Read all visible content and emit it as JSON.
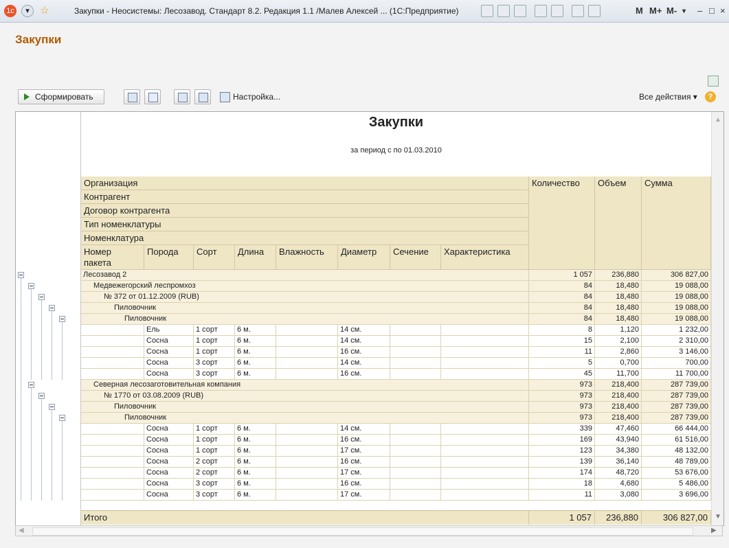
{
  "window": {
    "title": "Закупки - Неосистемы: Лесозавод. Стандарт 8.2. Редакция 1.1 /Малев Алексей ... (1С:Предприятие)",
    "memory_buttons": [
      "M",
      "M+",
      "M-"
    ]
  },
  "page": {
    "title": "Закупки"
  },
  "toolbar": {
    "form_label": "Сформировать",
    "setup_label": "Настройка...",
    "all_actions_label": "Все действия ▾"
  },
  "report": {
    "title": "Закупки",
    "subtitle": "за период с  по 01.03.2010",
    "headers": {
      "organization": "Организация",
      "counterparty": "Контрагент",
      "contract": "Договор контрагента",
      "nomenclature_type": "Тип номенклатуры",
      "nomenclature": "Номенклатура",
      "package_number": "Номер пакета",
      "breed": "Порода",
      "grade": "Сорт",
      "length": "Длина",
      "moisture": "Влажность",
      "diameter": "Диаметр",
      "section": "Сечение",
      "characteristic": "Характеристика",
      "quantity": "Количество",
      "volume": "Объем",
      "sum": "Сумма"
    },
    "rows": [
      {
        "type": "group",
        "level": 0,
        "label": "Лесозавод 2",
        "qty": "1 057",
        "vol": "236,880",
        "sum": "306 827,00"
      },
      {
        "type": "group",
        "level": 1,
        "label": "Медвежегорский леспромхоз",
        "qty": "84",
        "vol": "18,480",
        "sum": "19 088,00"
      },
      {
        "type": "group",
        "level": 2,
        "label": "№ 372 от 01.12.2009 (RUB)",
        "qty": "84",
        "vol": "18,480",
        "sum": "19 088,00"
      },
      {
        "type": "group",
        "level": 3,
        "label": "Пиловочник",
        "qty": "84",
        "vol": "18,480",
        "sum": "19 088,00"
      },
      {
        "type": "group",
        "level": 4,
        "label": "Пиловочник",
        "qty": "84",
        "vol": "18,480",
        "sum": "19 088,00"
      },
      {
        "type": "detail",
        "breed": "Ель",
        "grade": "1 сорт",
        "length": "6 м.",
        "diameter": "14 см.",
        "qty": "8",
        "vol": "1,120",
        "sum": "1 232,00"
      },
      {
        "type": "detail",
        "breed": "Сосна",
        "grade": "1 сорт",
        "length": "6 м.",
        "diameter": "14 см.",
        "qty": "15",
        "vol": "2,100",
        "sum": "2 310,00"
      },
      {
        "type": "detail",
        "breed": "Сосна",
        "grade": "1 сорт",
        "length": "6 м.",
        "diameter": "16 см.",
        "qty": "11",
        "vol": "2,860",
        "sum": "3 146,00"
      },
      {
        "type": "detail",
        "breed": "Сосна",
        "grade": "3 сорт",
        "length": "6 м.",
        "diameter": "14 см.",
        "qty": "5",
        "vol": "0,700",
        "sum": "700,00"
      },
      {
        "type": "detail",
        "breed": "Сосна",
        "grade": "3 сорт",
        "length": "6 м.",
        "diameter": "16 см.",
        "qty": "45",
        "vol": "11,700",
        "sum": "11 700,00"
      },
      {
        "type": "group",
        "level": 1,
        "label": "Северная лесозаготовительная компания",
        "qty": "973",
        "vol": "218,400",
        "sum": "287 739,00"
      },
      {
        "type": "group",
        "level": 2,
        "label": "№ 1770 от 03.08.2009 (RUB)",
        "qty": "973",
        "vol": "218,400",
        "sum": "287 739,00"
      },
      {
        "type": "group",
        "level": 3,
        "label": "Пиловочник",
        "qty": "973",
        "vol": "218,400",
        "sum": "287 739,00"
      },
      {
        "type": "group",
        "level": 4,
        "label": "Пиловочник",
        "qty": "973",
        "vol": "218,400",
        "sum": "287 739,00"
      },
      {
        "type": "detail",
        "breed": "Сосна",
        "grade": "1 сорт",
        "length": "6 м.",
        "diameter": "14 см.",
        "qty": "339",
        "vol": "47,460",
        "sum": "66 444,00"
      },
      {
        "type": "detail",
        "breed": "Сосна",
        "grade": "1 сорт",
        "length": "6 м.",
        "diameter": "16 см.",
        "qty": "169",
        "vol": "43,940",
        "sum": "61 516,00"
      },
      {
        "type": "detail",
        "breed": "Сосна",
        "grade": "1 сорт",
        "length": "6 м.",
        "diameter": "17 см.",
        "qty": "123",
        "vol": "34,380",
        "sum": "48 132,00"
      },
      {
        "type": "detail",
        "breed": "Сосна",
        "grade": "2 сорт",
        "length": "6 м.",
        "diameter": "16 см.",
        "qty": "139",
        "vol": "36,140",
        "sum": "48 789,00"
      },
      {
        "type": "detail",
        "breed": "Сосна",
        "grade": "2 сорт",
        "length": "6 м.",
        "diameter": "17 см.",
        "qty": "174",
        "vol": "48,720",
        "sum": "53 676,00"
      },
      {
        "type": "detail",
        "breed": "Сосна",
        "grade": "3 сорт",
        "length": "6 м.",
        "diameter": "16 см.",
        "qty": "18",
        "vol": "4,680",
        "sum": "5 486,00"
      },
      {
        "type": "detail",
        "breed": "Сосна",
        "grade": "3 сорт",
        "length": "6 м.",
        "diameter": "17 см.",
        "qty": "11",
        "vol": "3,080",
        "sum": "3 696,00"
      }
    ],
    "total": {
      "label": "Итого",
      "qty": "1 057",
      "vol": "236,880",
      "sum": "306 827,00"
    }
  }
}
